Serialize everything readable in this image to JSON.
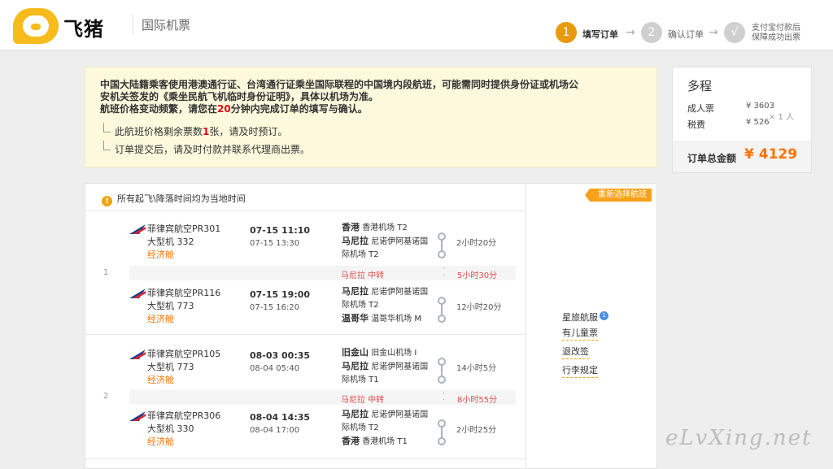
{
  "header": {
    "logo_text": "飞猪",
    "subtitle": "国际机票",
    "steps": [
      {
        "num": "1",
        "label": "填写订单",
        "active": true
      },
      {
        "num": "2",
        "label": "确认订单",
        "active": false
      },
      {
        "num": "√",
        "label_line1": "支付宝付款后",
        "label_line2": "保障成功出票",
        "active": false
      }
    ]
  },
  "notice": {
    "line1": "中国大陆籍乘客使用港澳通行证、台湾通行证乘坐国际联程的中国境内段航班，可能需同时提供身份证或机场公",
    "line2": "安机关签发的《乘坐民航飞机临时身份证明》，具体以机场为准。",
    "line3_pre": "航班价格变动频繁，请您在",
    "line3_num": "20",
    "line3_post": "分钟内完成订单的填写与确认。",
    "item1_pre": "此航班价格剩余票数",
    "item1_num": "1",
    "item1_post": "张，请及时预订。",
    "item2": "订单提交后，请及时付款并联系代理商出票。"
  },
  "summary": {
    "title": "多程",
    "adult_label": "成人票",
    "adult_price": "¥ 3603",
    "tax_label": "税费",
    "tax_price": "¥ 526",
    "multiplier": "× 1 人",
    "total_label": "订单总金额",
    "total_value": "¥ 4129"
  },
  "flights": {
    "tz_note": "所有起飞\\降落时间均为当地时间",
    "reselect": "重新选择航班",
    "trips": [
      {
        "index": "1",
        "segments": [
          {
            "airline": "菲律宾航空PR301",
            "aircraft": "大型机 332",
            "cabin": "经济舱",
            "dep": "07-15 11:10",
            "arr": "07-15 13:30",
            "from_city": "香港",
            "from_airport": "香港机场 T2",
            "to_city": "马尼拉",
            "to_airport": "尼诺伊阿基诺国",
            "to_airport2": "际机场 T2",
            "duration": "2小时20分"
          },
          {
            "airline": "菲律宾航空PR116",
            "aircraft": "大型机 773",
            "cabin": "经济舱",
            "dep": "07-15 19:00",
            "arr": "07-15 16:20",
            "from_city": "马尼拉",
            "from_airport": "尼诺伊阿基诺国",
            "from_airport2": "际机场 T2",
            "to_city": "温哥华",
            "to_airport": "温哥华机场 M",
            "duration": "12小时20分"
          }
        ],
        "transfer_city": "马尼拉 中转",
        "transfer_time": "5小时30分"
      },
      {
        "index": "2",
        "segments": [
          {
            "airline": "菲律宾航空PR105",
            "aircraft": "大型机 773",
            "cabin": "经济舱",
            "dep": "08-03 00:35",
            "arr": "08-04 05:40",
            "from_city": "旧金山",
            "from_airport": "旧金山机场 I",
            "to_city": "马尼拉",
            "to_airport": "尼诺伊阿基诺国",
            "to_airport2": "际机场 T1",
            "duration": "14小时5分"
          },
          {
            "airline": "菲律宾航空PR306",
            "aircraft": "大型机 330",
            "cabin": "经济舱",
            "dep": "08-04 14:35",
            "arr": "08-04 17:00",
            "from_city": "马尼拉",
            "from_airport": "尼诺伊阿基诺国",
            "from_airport2": "际机场 T2",
            "to_city": "香港",
            "to_airport": "香港机场 T1",
            "duration": "2小时25分"
          }
        ],
        "transfer_city": "马尼拉 中转",
        "transfer_time": "8小时55分"
      }
    ],
    "side_links": {
      "alliance": "星旅航服",
      "alliance_badge": "1",
      "child": "有儿童票",
      "refund": "退改签",
      "baggage": "行李规定"
    }
  },
  "watermark": "eLvXing.net"
}
